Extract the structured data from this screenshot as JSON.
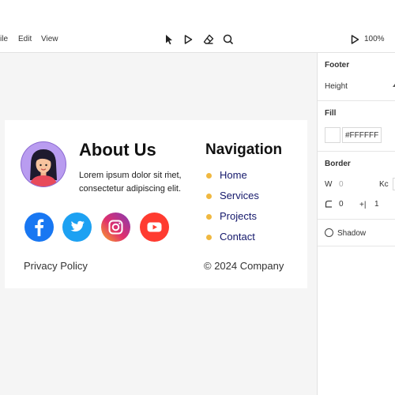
{
  "menu": {
    "file": "ile",
    "edit": "Edit",
    "view": "View"
  },
  "toolbar": {
    "tools": [
      "select-tool",
      "play-tool",
      "eraser-tool",
      "search-tool"
    ],
    "zoom": "100%"
  },
  "panel": {
    "section_title": "Footer",
    "height_label": "Height",
    "fill_title": "Fill",
    "fill_value": "#FFFFFF",
    "border_title": "Border",
    "w_label": "W",
    "w_value": "0",
    "kc_label": "Kc",
    "radius_value": "0",
    "spacing_label": "+|",
    "spacing_value": "1",
    "shadow_label": "Shadow"
  },
  "footer": {
    "about_title": "About Us",
    "about_text": "Lorem ipsum dolor sit ṁet, consectetur adipiscing elit.",
    "nav_title": "Navigation",
    "nav_items": [
      "Home",
      "Services",
      "Projects",
      "Contact"
    ],
    "privacy": "Privacy Policy",
    "copyright": "© 2024 Company"
  },
  "colors": {
    "facebook": "#1877f2",
    "twitter": "#1da1f2",
    "youtube": "#ff3b30",
    "bullet": "#f0b840",
    "nav_text": "#14186b"
  }
}
